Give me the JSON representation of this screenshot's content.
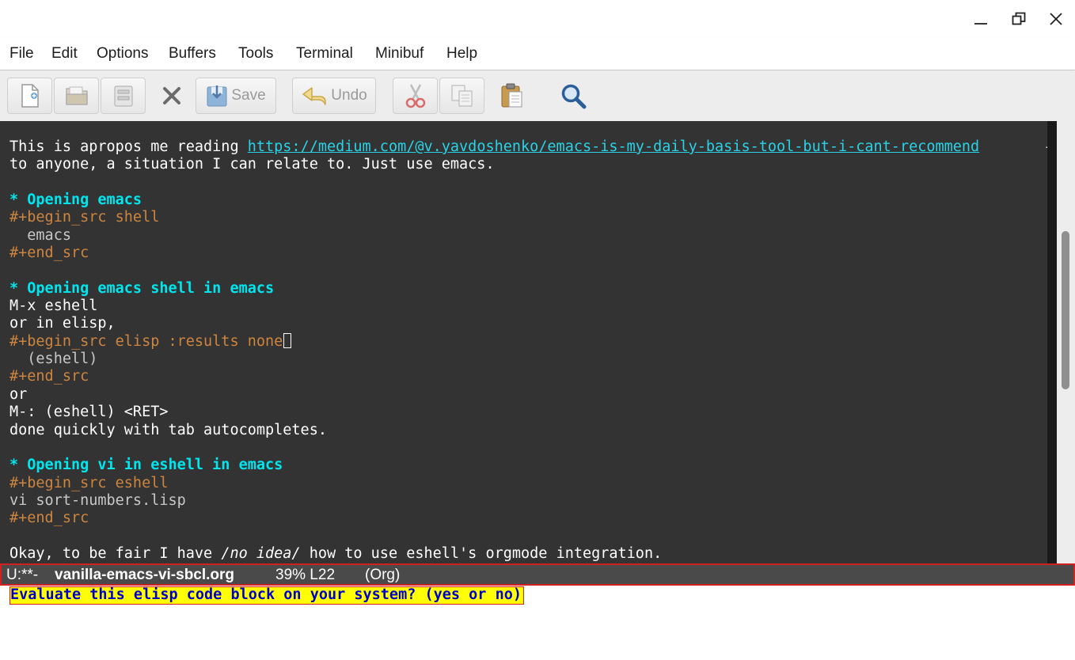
{
  "window": {
    "controls": {
      "minimize": "minimize-icon",
      "maximize": "maximize-icon",
      "close": "close-icon"
    }
  },
  "menu": {
    "items": [
      "File",
      "Edit",
      "Options",
      "Buffers",
      "Tools",
      "Terminal",
      "Minibuf",
      "Help"
    ]
  },
  "toolbar": {
    "new": "new-file-icon",
    "open": "open-folder-icon",
    "dired": "directory-icon",
    "close": "close-buffer-icon",
    "save_label": "Save",
    "undo_label": "Undo",
    "cut": "cut-icon",
    "copy": "copy-icon",
    "paste": "paste-icon",
    "search": "search-icon"
  },
  "editor": {
    "line1_text": "This is apropos me reading ",
    "line1_link": "https://medium.com/@v.yavdoshenko/emacs-is-my-daily-basis-tool-but-i-cant-recommend",
    "line1_wrap": "→",
    "line2": "to anyone, a situation I can relate to. Just use emacs.",
    "h1": "* Opening emacs",
    "src1_begin": "#+begin_src shell",
    "src1_body": "  emacs",
    "src1_end": "#+end_src",
    "h2": "* Opening emacs shell in emacs",
    "l_mx": "M-x eshell",
    "l_or_elisp": "or in elisp,",
    "src2_begin": "#+begin_src elisp :results none",
    "src2_body": "  (eshell)",
    "src2_end": "#+end_src",
    "l_or": "or",
    "l_mcolon": "M-: (eshell) <RET>",
    "l_done": "done quickly with tab autocompletes.",
    "h3": "* Opening vi in eshell in emacs",
    "src3_begin": "#+begin_src eshell",
    "src3_body": "vi sort-numbers.lisp",
    "src3_end": "#+end_src",
    "last_pre": "Okay, to be fair I have ",
    "last_emph": "/no idea/",
    "last_post": " how to use eshell's orgmode integration."
  },
  "modeline": {
    "state": "U:**-",
    "buffer": "vanilla-emacs-vi-sbcl.org",
    "position": "39% L22",
    "mode": "(Org)"
  },
  "minibuffer": {
    "prompt": "Evaluate this elisp code block on your system? (yes or no)"
  },
  "colors": {
    "editor_bg": "#333333",
    "heading": "#00e5ee",
    "keyword": "#cd853f",
    "link": "#29d3e7",
    "prompt_bg": "#ffff00",
    "prompt_fg": "#0000cd"
  }
}
